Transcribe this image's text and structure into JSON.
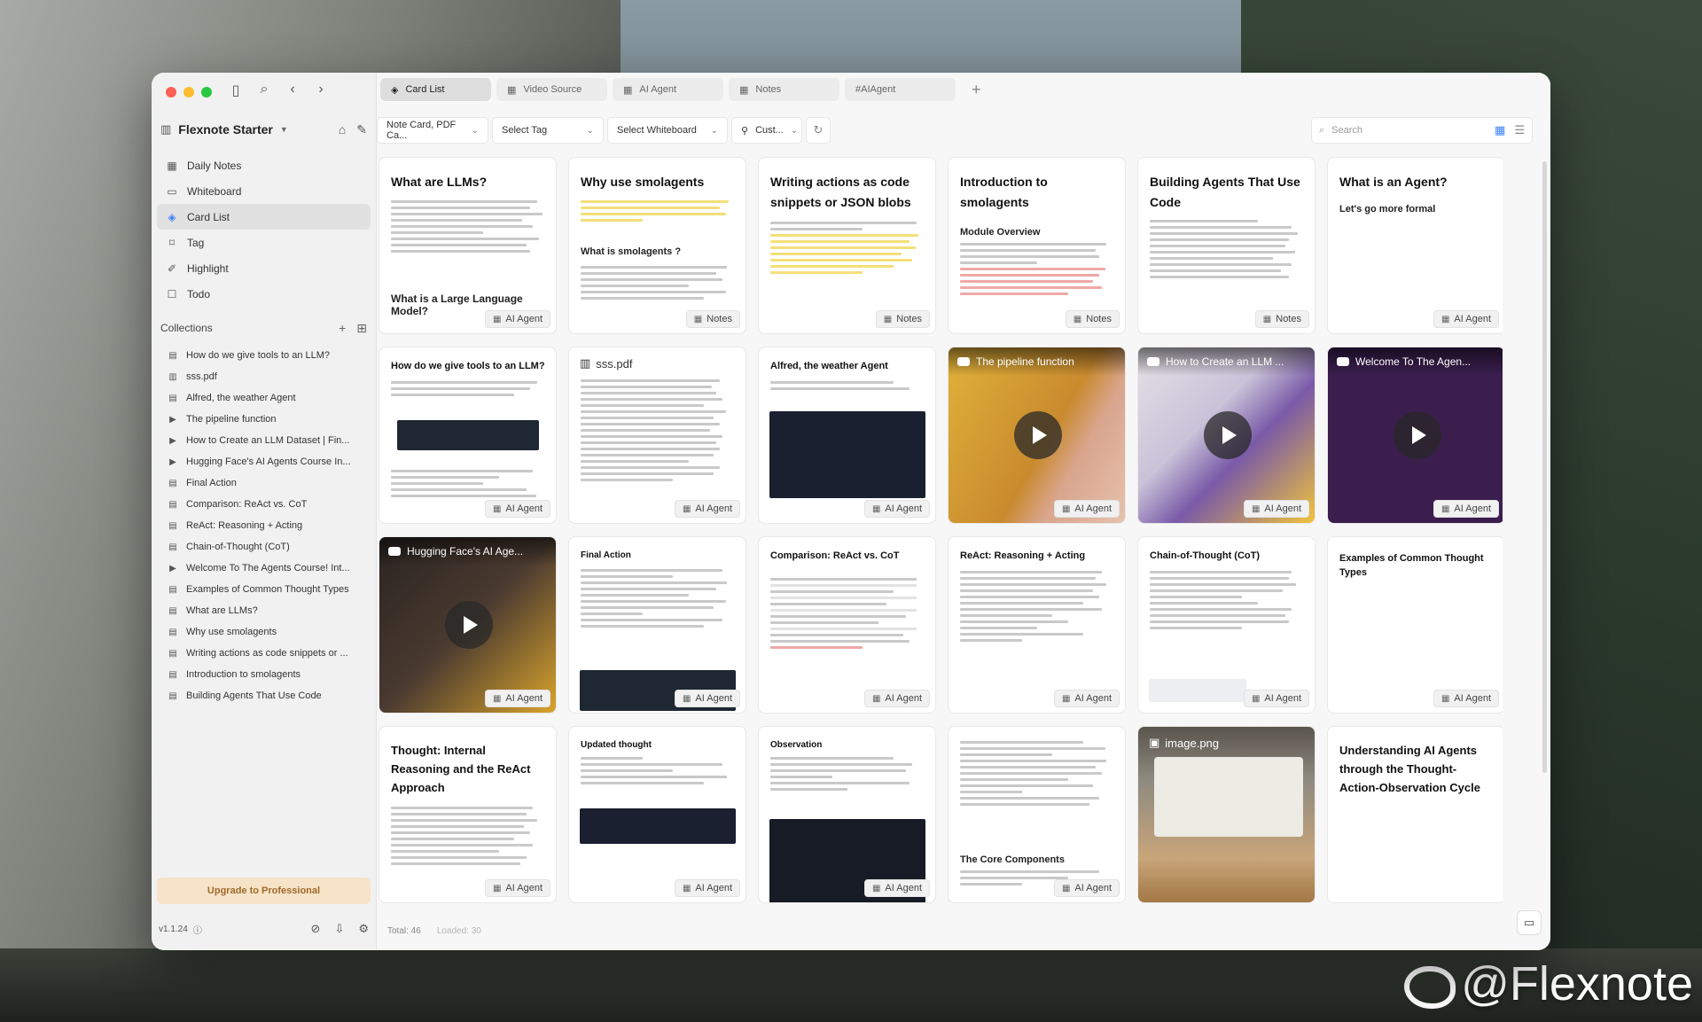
{
  "watermark": "@Flexnote",
  "sidebar": {
    "workspace": "Flexnote Starter",
    "nav": [
      {
        "label": "Daily Notes",
        "icon": "calendar-icon"
      },
      {
        "label": "Whiteboard",
        "icon": "whiteboard-icon"
      },
      {
        "label": "Card List",
        "icon": "stack-icon",
        "active": true
      },
      {
        "label": "Tag",
        "icon": "tag-icon"
      },
      {
        "label": "Highlight",
        "icon": "highlighter-icon"
      },
      {
        "label": "Todo",
        "icon": "checkbox-icon"
      }
    ],
    "collections_label": "Collections",
    "collections": [
      {
        "label": "How do we give tools to an LLM?",
        "icon": "doc-icon"
      },
      {
        "label": "sss.pdf",
        "icon": "pdf-icon"
      },
      {
        "label": "Alfred, the weather Agent",
        "icon": "doc-icon"
      },
      {
        "label": "The pipeline function",
        "icon": "video-icon"
      },
      {
        "label": "How to Create an LLM Dataset | Fin...",
        "icon": "video-icon"
      },
      {
        "label": "Hugging Face's AI Agents Course In...",
        "icon": "video-icon"
      },
      {
        "label": "Final Action",
        "icon": "doc-icon"
      },
      {
        "label": "Comparison: ReAct vs. CoT",
        "icon": "doc-icon"
      },
      {
        "label": "ReAct: Reasoning + Acting",
        "icon": "doc-icon"
      },
      {
        "label": "Chain-of-Thought (CoT)",
        "icon": "doc-icon"
      },
      {
        "label": "Welcome To The Agents Course! Int...",
        "icon": "video-icon"
      },
      {
        "label": "Examples of Common Thought Types",
        "icon": "doc-icon"
      },
      {
        "label": "What are LLMs?",
        "icon": "doc-icon"
      },
      {
        "label": "Why use smolagents",
        "icon": "doc-icon"
      },
      {
        "label": "Writing actions as code snippets or ...",
        "icon": "doc-icon"
      },
      {
        "label": "Introduction to smolagents",
        "icon": "doc-icon"
      },
      {
        "label": "Building Agents That Use Code",
        "icon": "doc-icon"
      }
    ],
    "upgrade": "Upgrade to Professional",
    "version": "v1.1.24"
  },
  "tabs": [
    {
      "label": "Card List",
      "active": true
    },
    {
      "label": "Video Source"
    },
    {
      "label": "AI Agent"
    },
    {
      "label": "Notes"
    },
    {
      "label": "#AIAgent"
    }
  ],
  "filters": {
    "type": "Note Card, PDF Ca...",
    "tag": "Select Tag",
    "whiteboard": "Select Whiteboard",
    "custom": "Cust..."
  },
  "search": {
    "placeholder": "Search"
  },
  "status": {
    "total": "Total: 46",
    "loaded": "Loaded: 30"
  },
  "cards": [
    {
      "title": "What are LLMs?",
      "sub": "What is a Large Language Model?",
      "badge": "AI Agent"
    },
    {
      "title": "Why use smolagents",
      "sub": "What is smolagents ?",
      "badge": "Notes"
    },
    {
      "title": "Writing actions as code snippets or JSON blobs",
      "badge": "Notes"
    },
    {
      "title": "Introduction to smolagents",
      "sub": "Module Overview",
      "badge": "Notes"
    },
    {
      "title": "Building Agents That Use Code",
      "badge": "Notes"
    },
    {
      "title": "What is an Agent?",
      "sub": "Let's go more formal",
      "badge": "AI Agent"
    },
    {
      "title": "How do we give tools to an LLM?",
      "badge": "AI Agent"
    },
    {
      "title": "sss.pdf",
      "badge": "AI Agent"
    },
    {
      "title": "Alfred, the weather Agent",
      "badge": "AI Agent"
    },
    {
      "title": "The pipeline function",
      "badge": "AI Agent"
    },
    {
      "title": "How to Create an LLM ...",
      "badge": "AI Agent"
    },
    {
      "title": "Welcome To The Agen...",
      "badge": "AI Agent"
    },
    {
      "title": "Hugging Face's AI Age...",
      "badge": "AI Agent"
    },
    {
      "title": "Final Action",
      "badge": "AI Agent"
    },
    {
      "title": "Comparison: ReAct vs. CoT",
      "badge": "AI Agent"
    },
    {
      "title": "ReAct: Reasoning + Acting",
      "badge": "AI Agent"
    },
    {
      "title": "Chain-of-Thought (CoT)",
      "badge": "AI Agent"
    },
    {
      "title": "Examples of Common Thought Types",
      "badge": "AI Agent"
    },
    {
      "title": "Thought: Internal Reasoning and the ReAct Approach",
      "badge": "AI Agent"
    },
    {
      "title": "Updated thought",
      "badge": "AI Agent"
    },
    {
      "title": "Observation",
      "badge": "AI Agent"
    },
    {
      "title": "The Core Components",
      "badge": "AI Agent"
    },
    {
      "title": "image.png"
    },
    {
      "title": "Understanding AI Agents through the Thought-Action-Observation Cycle"
    }
  ]
}
